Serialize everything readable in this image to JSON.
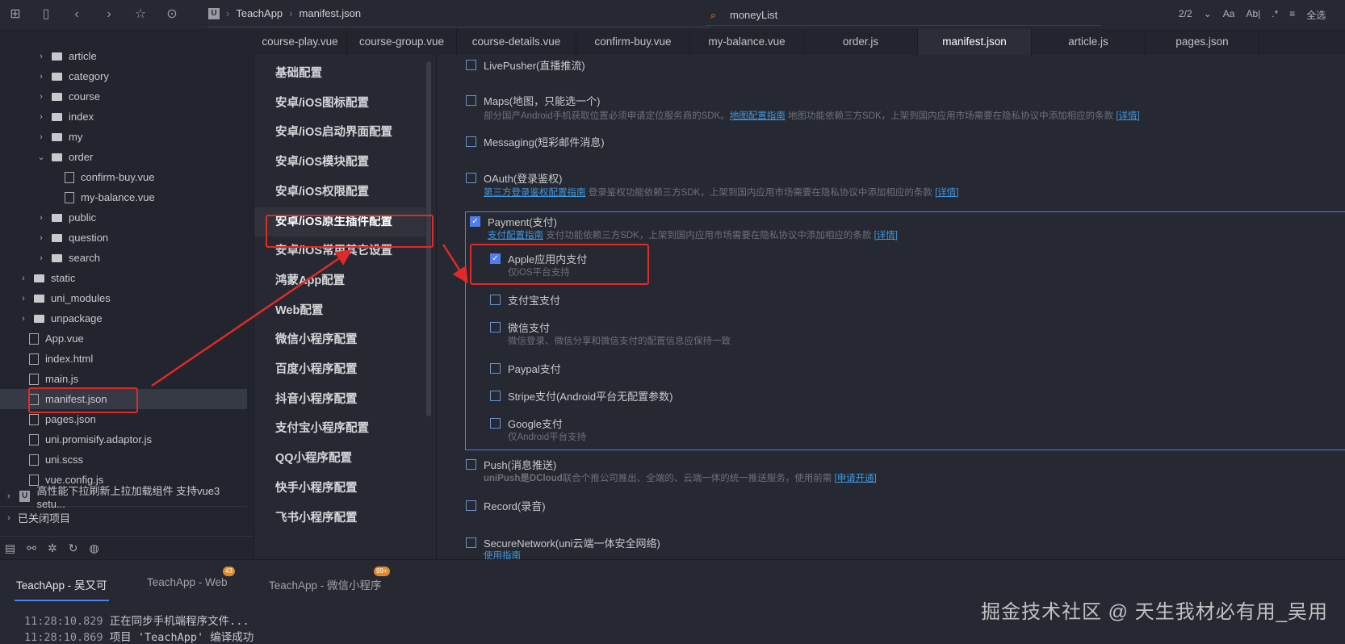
{
  "toolbar": {
    "icons": [
      "new-file-icon",
      "save-icon",
      "back-icon",
      "forward-icon",
      "star-icon",
      "run-icon"
    ],
    "breadcrumb": [
      "TeachApp",
      "manifest.json"
    ],
    "search_value": "moneyList",
    "find_count": "2/2",
    "find_tools": [
      "Aa",
      "Ab|",
      ".*",
      "≡",
      "全选"
    ]
  },
  "tabs": [
    {
      "label": "course-play.vue"
    },
    {
      "label": "course-group.vue"
    },
    {
      "label": "course-details.vue"
    },
    {
      "label": "confirm-buy.vue"
    },
    {
      "label": "my-balance.vue"
    },
    {
      "label": "order.js"
    },
    {
      "label": "manifest.json",
      "active": true
    },
    {
      "label": "article.js"
    },
    {
      "label": "pages.json"
    }
  ],
  "tree": [
    {
      "label": "article",
      "type": "folder",
      "depth": 2
    },
    {
      "label": "category",
      "type": "folder",
      "depth": 2
    },
    {
      "label": "course",
      "type": "folder",
      "depth": 2
    },
    {
      "label": "index",
      "type": "folder",
      "depth": 2
    },
    {
      "label": "my",
      "type": "folder",
      "depth": 2
    },
    {
      "label": "order",
      "type": "folder-open",
      "depth": 2
    },
    {
      "label": "confirm-buy.vue",
      "type": "file",
      "depth": 3
    },
    {
      "label": "my-balance.vue",
      "type": "file",
      "depth": 3
    },
    {
      "label": "public",
      "type": "folder",
      "depth": 2
    },
    {
      "label": "question",
      "type": "folder",
      "depth": 2
    },
    {
      "label": "search",
      "type": "folder",
      "depth": 2
    },
    {
      "label": "static",
      "type": "folder",
      "depth": 1
    },
    {
      "label": "uni_modules",
      "type": "folder",
      "depth": 1
    },
    {
      "label": "unpackage",
      "type": "folder",
      "depth": 1
    },
    {
      "label": "App.vue",
      "type": "file",
      "depth": 1
    },
    {
      "label": "index.html",
      "type": "file",
      "depth": 1
    },
    {
      "label": "main.js",
      "type": "file",
      "depth": 1
    },
    {
      "label": "manifest.json",
      "type": "file",
      "depth": 1,
      "selected": true
    },
    {
      "label": "pages.json",
      "type": "file",
      "depth": 1
    },
    {
      "label": "uni.promisify.adaptor.js",
      "type": "file",
      "depth": 1
    },
    {
      "label": "uni.scss",
      "type": "file",
      "depth": 1
    },
    {
      "label": "vue.config.js",
      "type": "file",
      "depth": 1
    }
  ],
  "other_project": "高性能下拉刷新上拉加载组件 支持vue3 setu...",
  "closed_projects": "已关闭项目",
  "config_menu": [
    "基础配置",
    "安卓/iOS图标配置",
    "安卓/iOS启动界面配置",
    "安卓/iOS模块配置",
    "安卓/iOS权限配置",
    "安卓/iOS原生插件配置",
    "安卓/iOS常用其它设置",
    "鸿蒙App配置",
    "Web配置",
    "微信小程序配置",
    "百度小程序配置",
    "抖音小程序配置",
    "支付宝小程序配置",
    "QQ小程序配置",
    "快手小程序配置",
    "飞书小程序配置"
  ],
  "config_selected_index": 5,
  "modules": {
    "livepusher": "LivePusher(直播推流)",
    "maps": {
      "label": "Maps(地图，只能选一个)",
      "desc": "部分国产Android手机获取位置必须申请定位服务商的SDK。",
      "link": "地图配置指南",
      "desc2": "地图功能依赖三方SDK，上架到国内应用市场需要在隐私协议中添加相应的条款",
      "detail": "[详情]"
    },
    "messaging": "Messaging(短彩邮件消息)",
    "oauth": {
      "label": "OAuth(登录鉴权)",
      "link": "第三方登录鉴权配置指南",
      "desc": "登录鉴权功能依赖三方SDK，上架到国内应用市场需要在隐私协议中添加相应的条款",
      "detail": "[详情]"
    },
    "payment": {
      "label": "Payment(支付)",
      "checked": true,
      "link": "支付配置指南",
      "desc": "支付功能依赖三方SDK，上架到国内应用市场需要在隐私协议中添加相应的条款",
      "detail": "[详情]",
      "apple": {
        "label": "Apple应用内支付",
        "sub": "仅iOS平台支持",
        "checked": true
      },
      "alipay": "支付宝支付",
      "wechat": {
        "label": "微信支付",
        "sub": "微信登录、微信分享和微信支付的配置信息应保持一致"
      },
      "paypal": "Paypal支付",
      "stripe": "Stripe支付(Android平台无配置参数)",
      "google": {
        "label": "Google支付",
        "sub": "仅Android平台支持"
      }
    },
    "push": {
      "label": "Push(消息推送)",
      "desc_bold": "uniPush是DCloud",
      "desc": "联合个推公司推出、全端的、云端一体的统一推送服务，使用前需",
      "link": "[申请开通]"
    },
    "record": "Record(录音)",
    "securenetwork": {
      "label": "SecureNetwork(uni云端一体安全网络)",
      "link": "使用指南"
    }
  },
  "console": {
    "tabs": [
      {
        "label": "TeachApp - 吴又可",
        "active": true
      },
      {
        "label": "TeachApp - Web",
        "badge": "43"
      },
      {
        "label": "TeachApp - 微信小程序",
        "badge": "99+"
      }
    ],
    "lines": [
      {
        "time": "11:28:10.829",
        "text": "正在同步手机端程序文件..."
      },
      {
        "time": "11:28:10.869",
        "text": "项目 'TeachApp' 编译成功"
      }
    ]
  },
  "watermark": "掘金技术社区 @ 天生我材必有用_吴用",
  "colors": {
    "accent": "#4e7ef0",
    "annotation": "#e02a2a",
    "link": "#3f97e0"
  }
}
